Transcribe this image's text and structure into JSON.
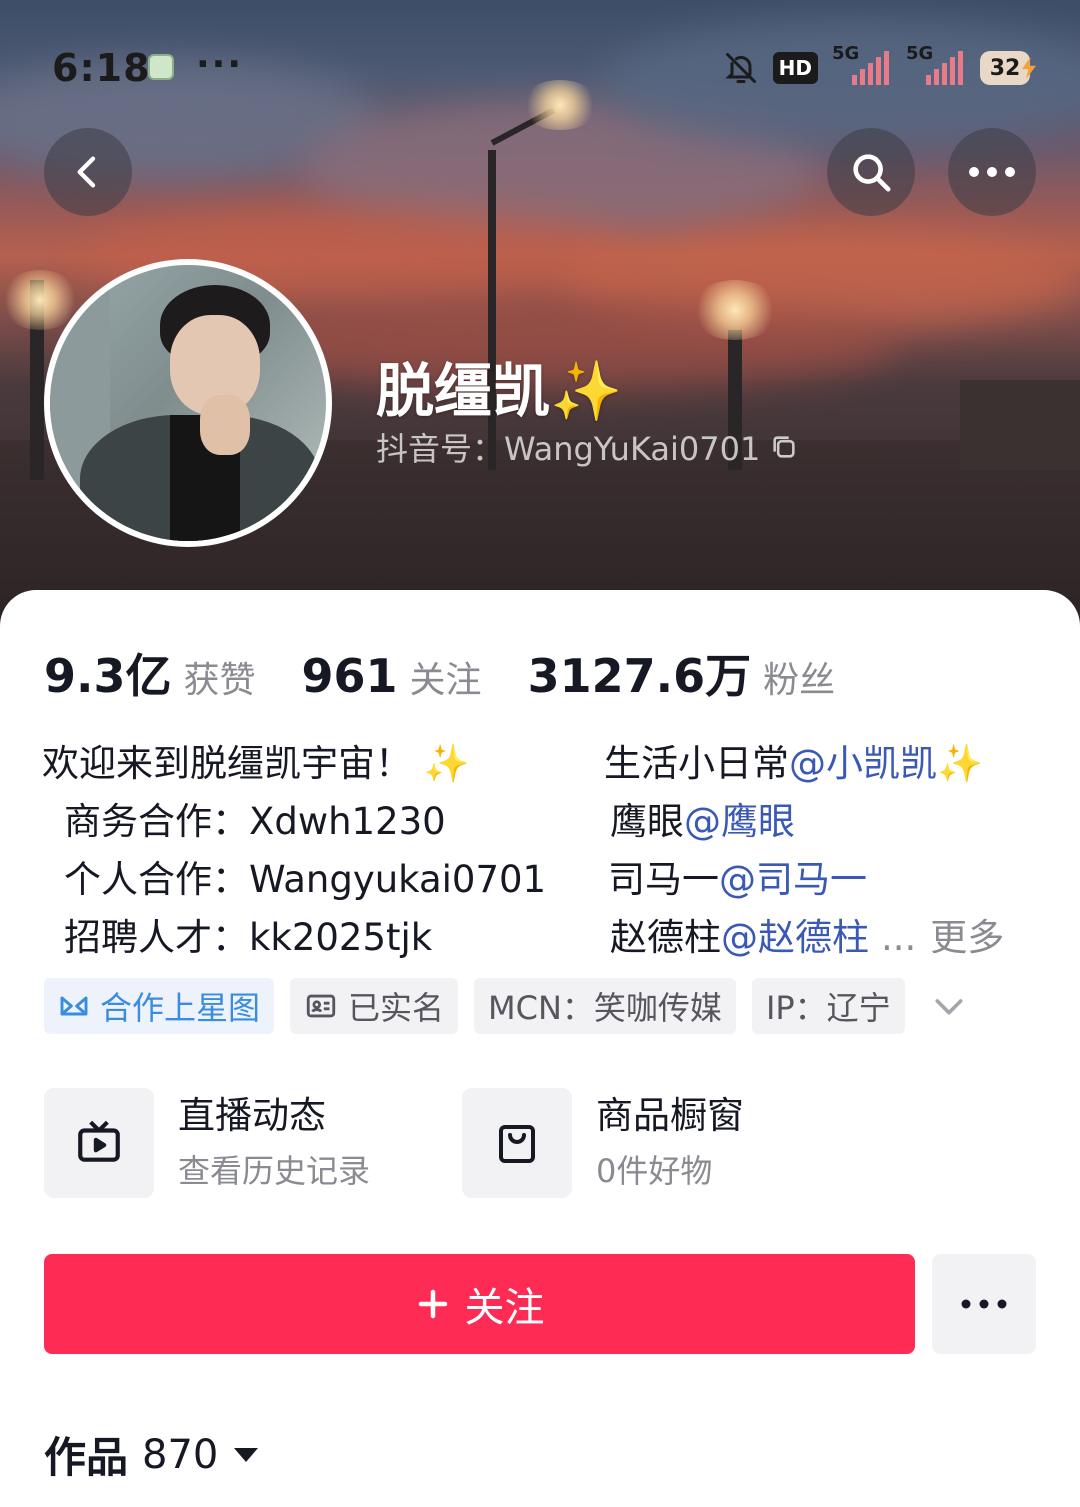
{
  "status_bar": {
    "time": "6:18",
    "hd_label": "HD",
    "signal1_label": "5G",
    "signal2_label": "5G",
    "battery": "32"
  },
  "header": {
    "back_icon": "chevron-left-icon",
    "search_icon": "search-icon",
    "more_icon": "more-icon"
  },
  "profile": {
    "nickname": "脱缰凯",
    "nickname_emoji": "✨",
    "douyin_id": "抖音号：WangYuKai0701"
  },
  "stats": [
    {
      "value": "9.3亿",
      "label": "获赞"
    },
    {
      "value": "961",
      "label": "关注"
    },
    {
      "value": "3127.6万",
      "label": "粉丝"
    }
  ],
  "bio": {
    "left": [
      "欢迎来到脱缰凯宇宙！ ✨",
      "商务合作：Xdwh1230",
      "个人合作：Wangyukai0701",
      "招聘人才：kk2025tjk"
    ],
    "right": [
      {
        "text": "生活小日常",
        "mention": "@小凯凯✨"
      },
      {
        "text": "鹰眼",
        "mention": "@鹰眼"
      },
      {
        "text": "司马一",
        "mention": "@司马一"
      },
      {
        "text": "赵德柱",
        "mention": "@赵德柱"
      }
    ],
    "ellipsis": "...",
    "more_label": "更多"
  },
  "tags": {
    "xingtu": "合作上星图",
    "verified": "已实名",
    "mcn": "MCN：笑咖传媒",
    "ip": "IP：辽宁"
  },
  "cards": [
    {
      "title": "直播动态",
      "subtitle": "查看历史记录",
      "icon": "tv-icon"
    },
    {
      "title": "商品橱窗",
      "subtitle": "0件好物",
      "icon": "shopping-bag-icon"
    }
  ],
  "actions": {
    "follow_label": "关注",
    "follow_color": "#fe2c55"
  },
  "works": {
    "label": "作品",
    "count": "870"
  },
  "colors": {
    "mention": "#3a58b5",
    "tag_primary": "#3a8ce0"
  }
}
